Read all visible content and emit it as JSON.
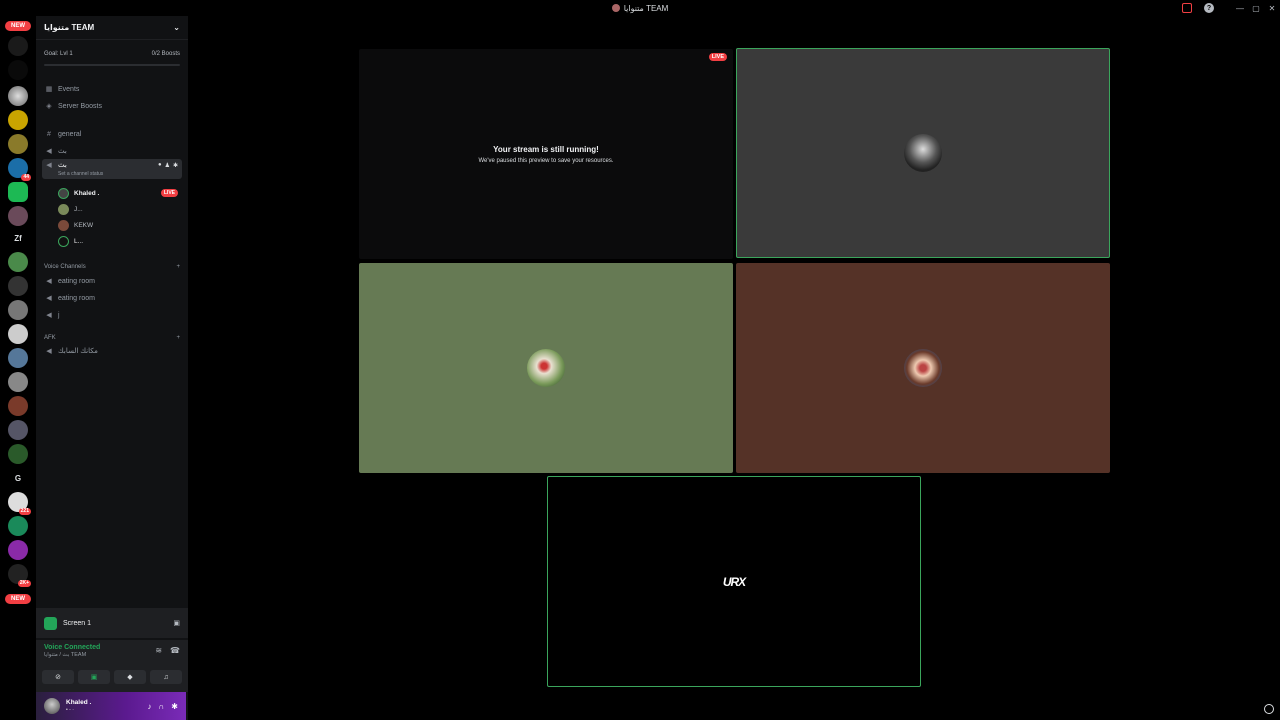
{
  "window": {
    "title": "متنوايا TEAM",
    "controls": [
      "—",
      "▢",
      "✕"
    ]
  },
  "guilds": {
    "new_badge_top": "NEW",
    "new_badge_bottom": "NEW",
    "badges": [
      "44",
      "221",
      "2K+"
    ],
    "letters": [
      "Zf",
      "G"
    ]
  },
  "server": {
    "name": "متنوايا TEAM",
    "goal_label": "Goal: Lvl 1",
    "boosts_label": "0/2 Boosts"
  },
  "nav": {
    "events": "Events",
    "server_boosts": "Server Boosts"
  },
  "channels": {
    "general": "general",
    "voice1": "بث",
    "active_voice": "بث",
    "active_status": "Set a channel status",
    "category_voice": "Voice Channels",
    "eating1": "eating room",
    "eating2": "eating room",
    "j": "j",
    "category_afk": "AFK",
    "afk_channel": "مكانك السابك"
  },
  "voice_users": [
    {
      "name": "Khaled .",
      "live": "LIVE"
    },
    {
      "name": "J..."
    },
    {
      "name": "KEKW"
    },
    {
      "name": "L..."
    }
  ],
  "screen_panel": {
    "label": "Screen 1"
  },
  "voice_panel": {
    "status": "Voice Connected",
    "channel": "بث / متنوايا TEAM"
  },
  "user_panel": {
    "name": "Khaled .",
    "sub": "• - ·"
  },
  "stage": {
    "stream_title": "Your stream is still running!",
    "stream_sub": "We've paused this preview to save your resources.",
    "live": "LIVE",
    "logo": "URX"
  },
  "colors": {
    "speaking": "#3ba55c",
    "live": "#f23f43",
    "tile_green": "#667a54",
    "tile_brown": "#553227",
    "tile_gray": "#3a3a3a"
  }
}
